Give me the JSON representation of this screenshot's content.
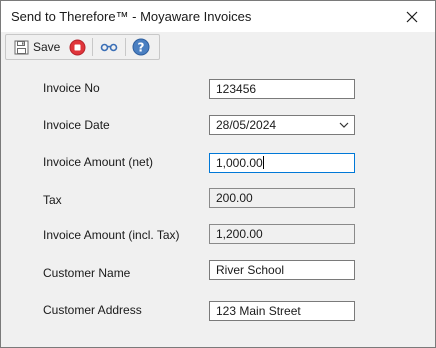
{
  "window": {
    "title": "Send to Therefore™ - Moyaware Invoices"
  },
  "toolbar": {
    "save_label": "Save"
  },
  "form": {
    "invoice_no": {
      "label": "Invoice No",
      "value": "123456"
    },
    "invoice_date": {
      "label": "Invoice Date",
      "value": "28/05/2024"
    },
    "invoice_amount_net": {
      "label": "Invoice Amount (net)",
      "value": "1,000.00"
    },
    "tax": {
      "label": "Tax",
      "value": "200.00"
    },
    "invoice_amount_incl_tax": {
      "label": "Invoice Amount (incl. Tax)",
      "value": "1,200.00"
    },
    "customer_name": {
      "label": "Customer Name",
      "value": "River School"
    },
    "customer_address": {
      "label": "Customer Address",
      "value": "123 Main Street"
    }
  },
  "colors": {
    "accent": "#0078d7",
    "stop_red": "#e0343a",
    "help_blue": "#4a7fc1"
  },
  "icons": [
    "close-icon",
    "save-icon",
    "stop-icon",
    "glasses-icon",
    "help-icon",
    "chevron-down-icon"
  ]
}
